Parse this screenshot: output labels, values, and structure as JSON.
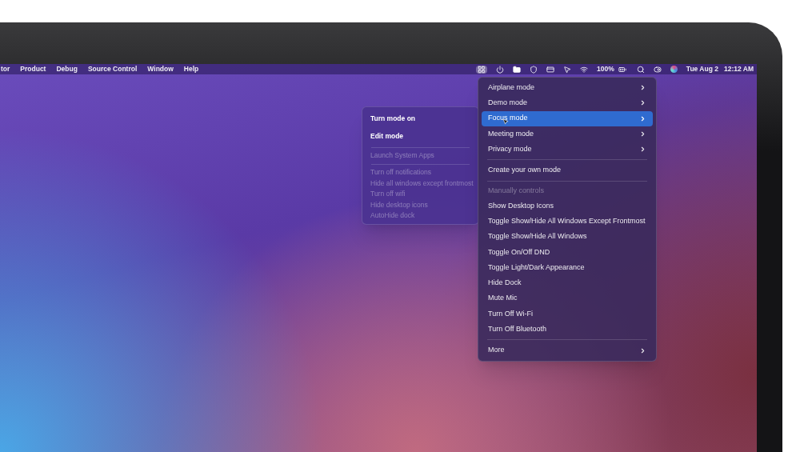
{
  "menubar": {
    "app_menus": [
      {
        "label": "tor"
      },
      {
        "label": "Product"
      },
      {
        "label": "Debug"
      },
      {
        "label": "Source Control"
      },
      {
        "label": "Window"
      },
      {
        "label": "Help"
      }
    ],
    "extras_open": true,
    "battery": "100%",
    "date": "Tue Aug 2",
    "time": "12:12 AM"
  },
  "main_menu": {
    "items": [
      {
        "kind": "item",
        "label": "Airplane mode",
        "submenu": true,
        "selected": false
      },
      {
        "kind": "item",
        "label": "Demo mode",
        "submenu": true,
        "selected": false
      },
      {
        "kind": "item",
        "label": "Focus mode",
        "submenu": true,
        "selected": true
      },
      {
        "kind": "item",
        "label": "Meeting mode",
        "submenu": true,
        "selected": false
      },
      {
        "kind": "item",
        "label": "Privacy mode",
        "submenu": true,
        "selected": false
      },
      {
        "kind": "separator"
      },
      {
        "kind": "item",
        "label": "Create your own mode",
        "submenu": false,
        "selected": false
      },
      {
        "kind": "separator"
      },
      {
        "kind": "header",
        "label": "Manually controls"
      },
      {
        "kind": "item",
        "label": "Show Desktop Icons",
        "submenu": false,
        "selected": false
      },
      {
        "kind": "item",
        "label": "Toggle Show/Hide All Windows Except Frontmost",
        "submenu": false,
        "selected": false
      },
      {
        "kind": "item",
        "label": "Toggle Show/Hide All Windows",
        "submenu": false,
        "selected": false
      },
      {
        "kind": "item",
        "label": "Toggle On/Off DND",
        "submenu": false,
        "selected": false
      },
      {
        "kind": "item",
        "label": "Toggle Light/Dark Appearance",
        "submenu": false,
        "selected": false
      },
      {
        "kind": "item",
        "label": "Hide Dock",
        "submenu": false,
        "selected": false
      },
      {
        "kind": "item",
        "label": "Mute Mic",
        "submenu": false,
        "selected": false
      },
      {
        "kind": "item",
        "label": "Turn Off Wi-Fi",
        "submenu": false,
        "selected": false
      },
      {
        "kind": "item",
        "label": "Turn Off Bluetooth",
        "submenu": false,
        "selected": false
      },
      {
        "kind": "separator"
      },
      {
        "kind": "item",
        "label": "More",
        "submenu": true,
        "selected": false
      }
    ]
  },
  "submenu": {
    "items": [
      {
        "kind": "item",
        "label": "Turn mode on",
        "disabled": false
      },
      {
        "kind": "item",
        "label": "Edit mode",
        "disabled": false
      },
      {
        "kind": "separator"
      },
      {
        "kind": "item",
        "label": "Launch System Apps",
        "disabled": true
      },
      {
        "kind": "separator"
      },
      {
        "kind": "item",
        "label": "Turn off notifications",
        "disabled": true
      },
      {
        "kind": "item",
        "label": "Hide all windows except frontmost",
        "disabled": true
      },
      {
        "kind": "item",
        "label": "Turn off wifi",
        "disabled": true
      },
      {
        "kind": "item",
        "label": "Hide desktop icons",
        "disabled": true
      },
      {
        "kind": "item",
        "label": "AutoHide dock",
        "disabled": true
      }
    ]
  }
}
